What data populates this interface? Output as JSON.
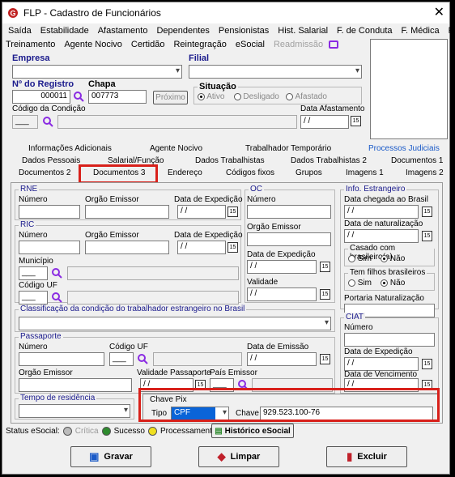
{
  "window": {
    "title": "FLP - Cadastro de Funcionários",
    "close": "✕"
  },
  "menu": {
    "row1": [
      "Saída",
      "Estabilidade",
      "Afastamento",
      "Dependentes",
      "Pensionistas",
      "Hist. Salarial",
      "F. de Conduta",
      "F. Médica",
      "Férias"
    ],
    "row2": [
      "Treinamento",
      "Agente Nocivo",
      "Certidão",
      "Reintegração",
      "eSocial"
    ],
    "row2_disabled": "Readmissão"
  },
  "header": {
    "empresa_label": "Empresa",
    "filial_label": "Filial",
    "registro_label": "Nº do Registro",
    "registro_value": "000011",
    "chapa_label": "Chapa",
    "chapa_value": "007773",
    "proximo_label": "Próximo",
    "situacao_label": "Situação",
    "situacao_options": [
      "Ativo",
      "Desligado",
      "Afastado"
    ],
    "codigo_condicao_label": "Código da Condição",
    "data_afastamento_label": "Data Afastamento",
    "date_placeholder": " / /",
    "dash": "___"
  },
  "tabs": {
    "row1": [
      "Informações Adicionais",
      "Agente Nocivo",
      "Trabalhador Temporário",
      "Processos Judiciais"
    ],
    "row2": [
      "Dados Pessoais",
      "Salarial/Função",
      "Dados Trabalhistas",
      "Dados Trabalhistas 2",
      "Documentos 1"
    ],
    "row3": [
      "Documentos 2",
      "Documentos 3",
      "Endereço",
      "Códigos fixos",
      "Grupos",
      "Imagens 1",
      "Imagens 2"
    ]
  },
  "rne": {
    "title": "RNE",
    "numero": "Número",
    "orgao": "Orgão Emissor",
    "data_exp": "Data de Expedição"
  },
  "oc": {
    "title": "OC",
    "numero": "Número",
    "orgao": "Orgão Emissor",
    "data_exp": "Data de Expedição",
    "validade": "Validade"
  },
  "ric": {
    "title": "RIC",
    "numero": "Número",
    "orgao": "Orgão Emissor",
    "data_exp": "Data de Expedição",
    "municipio": "Município",
    "codigo_uf": "Código UF"
  },
  "estrangeiro": {
    "title": "Info. Estrangeiro",
    "data_chegada": "Data chegada ao Brasil",
    "data_naturalizacao": "Data de naturalização",
    "casado_title": "Casado com brasileiro(a)",
    "filhos_title": "Tem filhos brasileiros",
    "sim": "Sim",
    "nao": "Não",
    "portaria": "Portaria Naturalização"
  },
  "classificacao": {
    "title": "Classificação da condição do trabalhador estrangeiro no Brasil"
  },
  "passaporte": {
    "title": "Passaporte",
    "numero": "Número",
    "codigo_uf": "Código UF",
    "data_emissao": "Data de Emissão",
    "orgao": "Orgão Emissor",
    "validade": "Validade Passaporte",
    "pais": "País Emissor"
  },
  "ciat": {
    "title": "CIAT",
    "numero": "Número",
    "data_exp": "Data de Expedição",
    "data_venc": "Data de Vencimento"
  },
  "tempo": {
    "title": "Tempo de residência"
  },
  "pix": {
    "title": "Chave Pix",
    "tipo_label": "Tipo",
    "tipo_value": "CPF",
    "chave_label": "Chave",
    "chave_value": "929.523.100-76"
  },
  "status": {
    "label": "Status eSocial:",
    "critica": "Crítica",
    "sucesso": "Sucesso",
    "processamento": "Processamento",
    "historico": "Histórico eSocial"
  },
  "buttons": {
    "gravar": "Gravar",
    "limpar": "Limpar",
    "excluir": "Excluir"
  },
  "colors": {
    "highlight": "#d8201a",
    "selection": "#0a64d8",
    "tab_link": "#1a5ac8",
    "success": "#2e8b2e",
    "warn": "#f0e020"
  }
}
